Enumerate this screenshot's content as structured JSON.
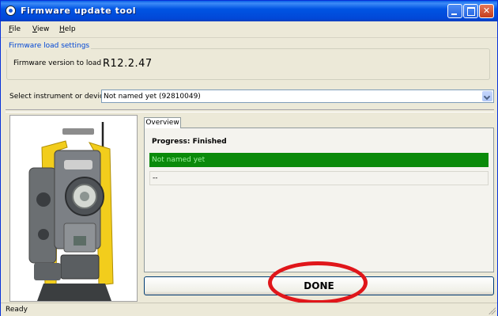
{
  "window": {
    "title": "Firmware update tool"
  },
  "menu": {
    "items": [
      "File",
      "View",
      "Help"
    ]
  },
  "firmware_settings": {
    "legend": "Firmware load settings",
    "version_label": "Firmware version to load",
    "version_value": "R12.2.47"
  },
  "device_select": {
    "label": "Select instrument or device",
    "selected": "Not named yet (92810049)"
  },
  "tabs": [
    {
      "label": "Overview"
    }
  ],
  "progress": {
    "label": "Progress: Finished",
    "status_text": "Not named yet",
    "status_color": "#0a8a0a",
    "detail_text": "--"
  },
  "done_button": {
    "label": "DONE"
  },
  "annotation": {
    "color": "#e0161a"
  },
  "statusbar": {
    "text": "Ready"
  },
  "icons": [
    "app-icon",
    "minimize-icon",
    "maximize-icon",
    "close-icon",
    "dropdown-arrow-icon",
    "resize-grip-icon"
  ]
}
